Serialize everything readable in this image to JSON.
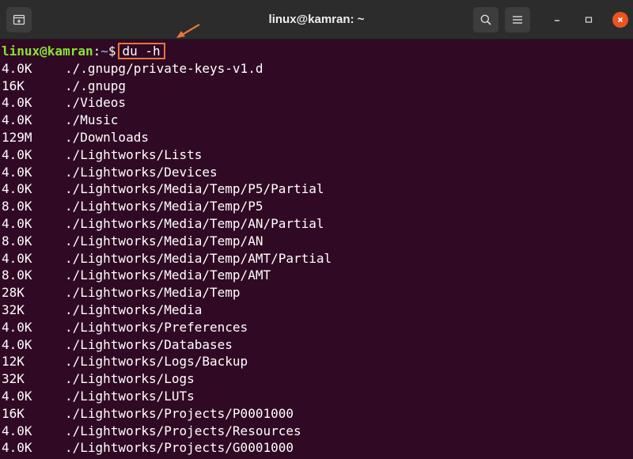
{
  "window": {
    "title": "linux@kamran: ~",
    "accent_color": "#e95420",
    "background_color": "#300a24",
    "icons": {
      "new_tab": "new-tab-icon",
      "search": "search-icon",
      "menu": "hamburger-menu-icon",
      "minimize": "minimize-icon",
      "maximize": "maximize-icon",
      "close": "close-icon"
    }
  },
  "prompt": {
    "user_host": "linux@kamran",
    "separator": ":",
    "cwd": "~",
    "symbol": "$",
    "command": "du -h"
  },
  "annotation": {
    "color": "#e8743b"
  },
  "output": [
    {
      "size": "4.0K",
      "path": "./.gnupg/private-keys-v1.d"
    },
    {
      "size": "16K",
      "path": "./.gnupg"
    },
    {
      "size": "4.0K",
      "path": "./Videos"
    },
    {
      "size": "4.0K",
      "path": "./Music"
    },
    {
      "size": "129M",
      "path": "./Downloads"
    },
    {
      "size": "4.0K",
      "path": "./Lightworks/Lists"
    },
    {
      "size": "4.0K",
      "path": "./Lightworks/Devices"
    },
    {
      "size": "4.0K",
      "path": "./Lightworks/Media/Temp/P5/Partial"
    },
    {
      "size": "8.0K",
      "path": "./Lightworks/Media/Temp/P5"
    },
    {
      "size": "4.0K",
      "path": "./Lightworks/Media/Temp/AN/Partial"
    },
    {
      "size": "8.0K",
      "path": "./Lightworks/Media/Temp/AN"
    },
    {
      "size": "4.0K",
      "path": "./Lightworks/Media/Temp/AMT/Partial"
    },
    {
      "size": "8.0K",
      "path": "./Lightworks/Media/Temp/AMT"
    },
    {
      "size": "28K",
      "path": "./Lightworks/Media/Temp"
    },
    {
      "size": "32K",
      "path": "./Lightworks/Media"
    },
    {
      "size": "4.0K",
      "path": "./Lightworks/Preferences"
    },
    {
      "size": "4.0K",
      "path": "./Lightworks/Databases"
    },
    {
      "size": "12K",
      "path": "./Lightworks/Logs/Backup"
    },
    {
      "size": "32K",
      "path": "./Lightworks/Logs"
    },
    {
      "size": "4.0K",
      "path": "./Lightworks/LUTs"
    },
    {
      "size": "16K",
      "path": "./Lightworks/Projects/P0001000"
    },
    {
      "size": "4.0K",
      "path": "./Lightworks/Projects/Resources"
    },
    {
      "size": "4.0K",
      "path": "./Lightworks/Projects/G0001000"
    }
  ]
}
